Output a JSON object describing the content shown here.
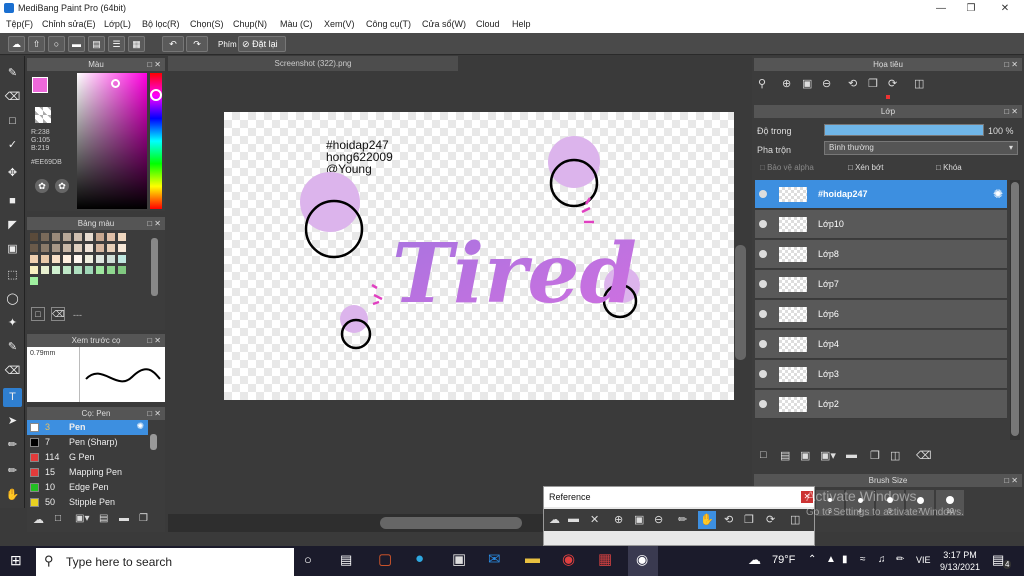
{
  "window": {
    "title": "MediBang Paint Pro (64bit)"
  },
  "menu": [
    "Tệp(F)",
    "Chỉnh sửa(E)",
    "Lớp(L)",
    "Bộ lọc(R)",
    "Chọn(S)",
    "Chụp(N)",
    "Màu (C)",
    "Xem(V)",
    "Công cụ(T)",
    "Cửa sổ(W)",
    "Cloud",
    "Help"
  ],
  "toolbar": {
    "key_label": "Phím",
    "reset_label": "Đặt lại"
  },
  "color_panel": {
    "title": "Màu",
    "r": "R:238",
    "g": "G:105",
    "b": "B:219",
    "hex": "#EE69DB",
    "fg": "#EE69DB",
    "bg": "#E0A0EE"
  },
  "palette_panel": {
    "title": "Bảng màu",
    "empty": "---"
  },
  "brush_preview": {
    "title": "Xem trước cọ",
    "size": "0.79mm"
  },
  "brush_panel": {
    "title": "Cọ: Pen",
    "items": [
      {
        "size": "3",
        "name": "Pen",
        "color": "#ffffff",
        "selected": true
      },
      {
        "size": "7",
        "name": "Pen (Sharp)",
        "color": "#000000"
      },
      {
        "size": "114",
        "name": "G Pen",
        "color": "#e23b3b"
      },
      {
        "size": "15",
        "name": "Mapping Pen",
        "color": "#e23b3b"
      },
      {
        "size": "10",
        "name": "Edge Pen",
        "color": "#22c022"
      },
      {
        "size": "50",
        "name": "Stipple Pen",
        "color": "#e8d020"
      }
    ]
  },
  "document": {
    "tab": "Screenshot (322).png"
  },
  "canvas_text": {
    "line1": "#hoidap247",
    "line2": "hong622009",
    "line3": "@Young",
    "art": "Tired"
  },
  "navigator": {
    "title": "Họa tiêu"
  },
  "layer_panel": {
    "title": "Lớp",
    "opacity_label": "Độ trong",
    "opacity_value": "100 %",
    "opacity_pct": 100,
    "blend_label": "Pha trộn",
    "blend_value": "Bình thường",
    "protect_alpha": "Bảo vệ alpha",
    "clipping": "Xén bớt",
    "lock": "Khóa",
    "layers": [
      "#hoidap247",
      "Lớp10",
      "Lớp8",
      "Lớp7",
      "Lớp6",
      "Lớp4",
      "Lớp3",
      "Lớp2"
    ]
  },
  "reference": {
    "title": "Reference"
  },
  "brush_size": {
    "title": "Brush Size",
    "sizes": [
      "1",
      "2",
      "3",
      "4",
      "5",
      "7",
      "10"
    ]
  },
  "watermark": {
    "line1": "Activate Windows",
    "line2": "Go to Settings to activate Windows."
  },
  "taskbar": {
    "search_placeholder": "Type here to search",
    "weather": "79°F",
    "lang": "VIE",
    "time": "3:17 PM",
    "date": "9/13/2021",
    "notif": "4"
  }
}
